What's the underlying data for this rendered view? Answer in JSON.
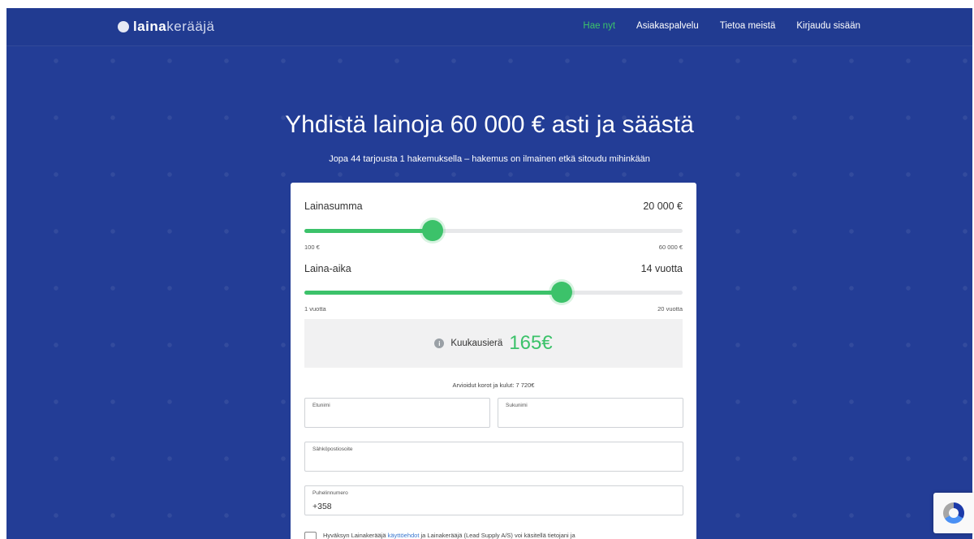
{
  "nav": {
    "logo_bold": "laina",
    "logo_light": "kerääjä",
    "links": [
      "Hae nyt",
      "Asiakaspalvelu",
      "Tietoa meistä",
      "Kirjaudu sisään"
    ]
  },
  "hero": {
    "title": "Yhdistä lainoja 60 000 € asti ja säästä",
    "subtitle": "Jopa 44 tarjousta 1 hakemuksella – hakemus on ilmainen etkä sitoudu mihinkään"
  },
  "calculator": {
    "amount": {
      "label": "Lainasumma",
      "value": "20 000 €",
      "min_label": "100 €",
      "max_label": "60 000 €",
      "fraction": 0.34
    },
    "term": {
      "label": "Laina-aika",
      "value": "14 vuotta",
      "min_label": "1 vuotta",
      "max_label": "20 vuotta",
      "fraction": 0.68
    },
    "monthly_label": "Kuukausierä",
    "monthly_value": "165€",
    "costs_text": "Arvioidut korot ja kulut: 7 720€"
  },
  "form": {
    "first_name_label": "Etunimi",
    "last_name_label": "Sukunimi",
    "email_label": "Sähköpostiosoite",
    "phone_label": "Puhelinnumero",
    "phone_value": "+358",
    "consent_prefix": "Hyväksyn Lainakerääjä",
    "consent_link": "käyttöehdot",
    "consent_suffix": "ja Lainakerääjä (Lead Supply A/S) voi käsitellä tietojani ja"
  },
  "colors": {
    "background": "#233d96",
    "accent": "#3cc26a",
    "link": "#3a78d0"
  }
}
